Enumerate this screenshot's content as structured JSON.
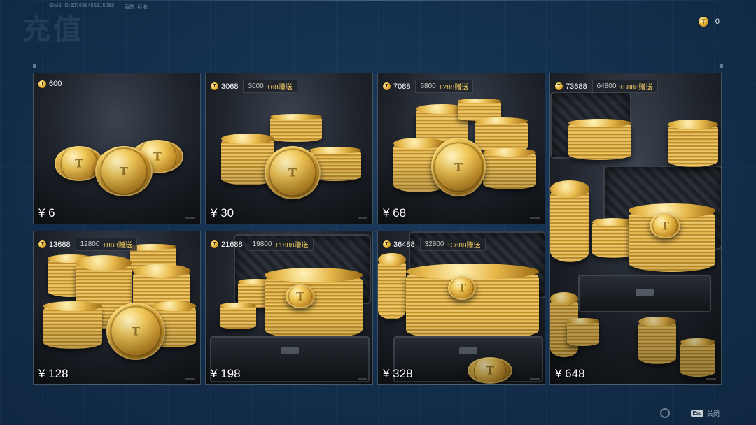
{
  "header": {
    "uid_label": "SIMS  ID:327658455315088",
    "server_label": "画质: 标准",
    "page_title": "充值",
    "balance": "0"
  },
  "currency_icon": "gold-coin-icon",
  "packages": [
    {
      "total": "600",
      "base": "",
      "bonus": "",
      "price": "¥ 6"
    },
    {
      "total": "3068",
      "base": "3000",
      "bonus": "+68赠送",
      "price": "¥ 30"
    },
    {
      "total": "7088",
      "base": "6800",
      "bonus": "+288赠送",
      "price": "¥ 68"
    },
    {
      "total": "73688",
      "base": "64800",
      "bonus": "+8888赠送",
      "price": "¥ 648"
    },
    {
      "total": "13688",
      "base": "12800",
      "bonus": "+888赠送",
      "price": "¥ 128"
    },
    {
      "total": "21688",
      "base": "19800",
      "bonus": "+1888赠送",
      "price": "¥ 198"
    },
    {
      "total": "36488",
      "base": "32800",
      "bonus": "+3688赠送",
      "price": "¥ 328"
    }
  ],
  "footer": {
    "esc_key": "Esc",
    "close_label": "关闭"
  },
  "colors": {
    "background": "#14304f",
    "gold": "#f3cd62",
    "card_border": "#96b4d2"
  }
}
